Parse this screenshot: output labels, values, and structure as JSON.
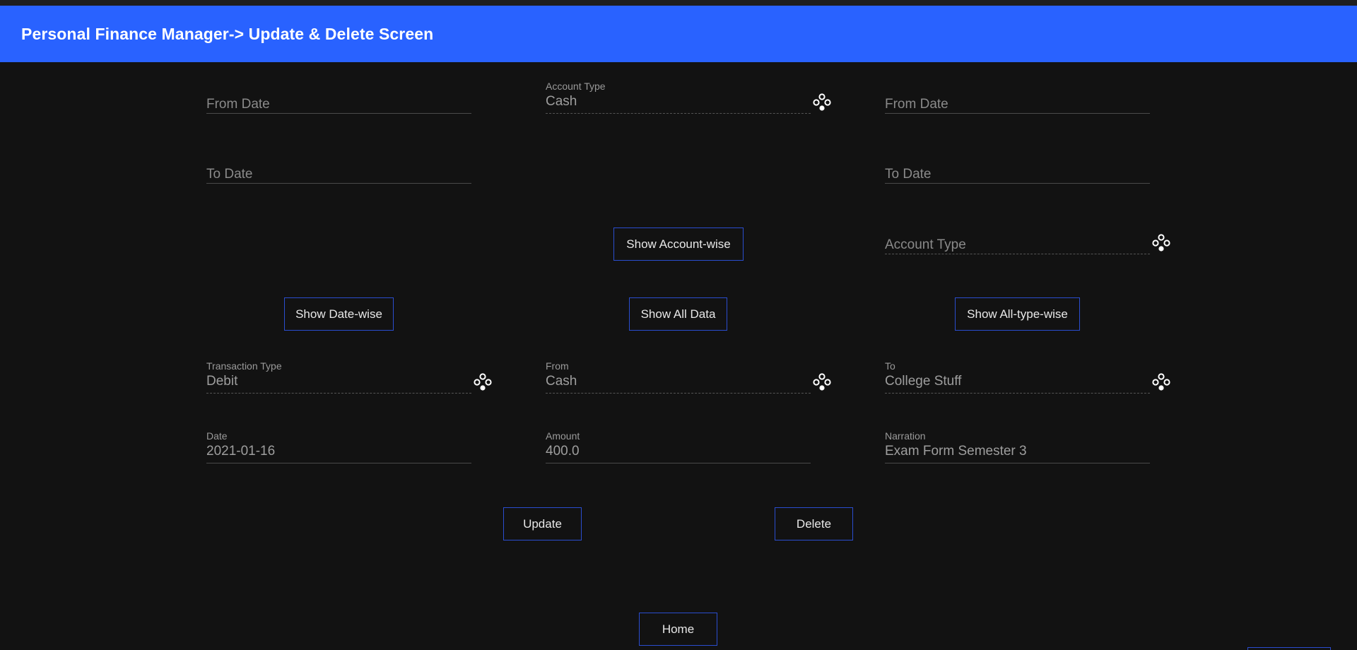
{
  "app_bar": {
    "title": "Personal Finance Manager-> Update & Delete Screen"
  },
  "date_filter": {
    "from_date_hint": "From Date",
    "to_date_hint": "To Date",
    "show_button": "Show Date-wise"
  },
  "account_filter": {
    "account_type_label": "Account Type",
    "account_type_value": "Cash",
    "show_button": "Show Account-wise",
    "show_all_button": "Show All Data"
  },
  "all_type_filter": {
    "from_date_hint": "From Date",
    "to_date_hint": "To Date",
    "account_type_hint": "Account Type",
    "show_button": "Show All-type-wise"
  },
  "transaction": {
    "type_label": "Transaction Type",
    "type_value": "Debit",
    "from_label": "From",
    "from_value": "Cash",
    "to_label": "To",
    "to_value": "College Stuff",
    "date_label": "Date",
    "date_value": "2021-01-16",
    "amount_label": "Amount",
    "amount_value": "400.0",
    "narration_label": "Narration",
    "narration_value": "Exam Form Semester 3"
  },
  "actions": {
    "update": "Update",
    "delete": "Delete",
    "home": "Home"
  },
  "icons": {
    "dropdown": "dropdown-circles-icon"
  },
  "colors": {
    "app_bar": "#2962ff",
    "background": "#121212",
    "button_border": "#2a4dcf"
  }
}
